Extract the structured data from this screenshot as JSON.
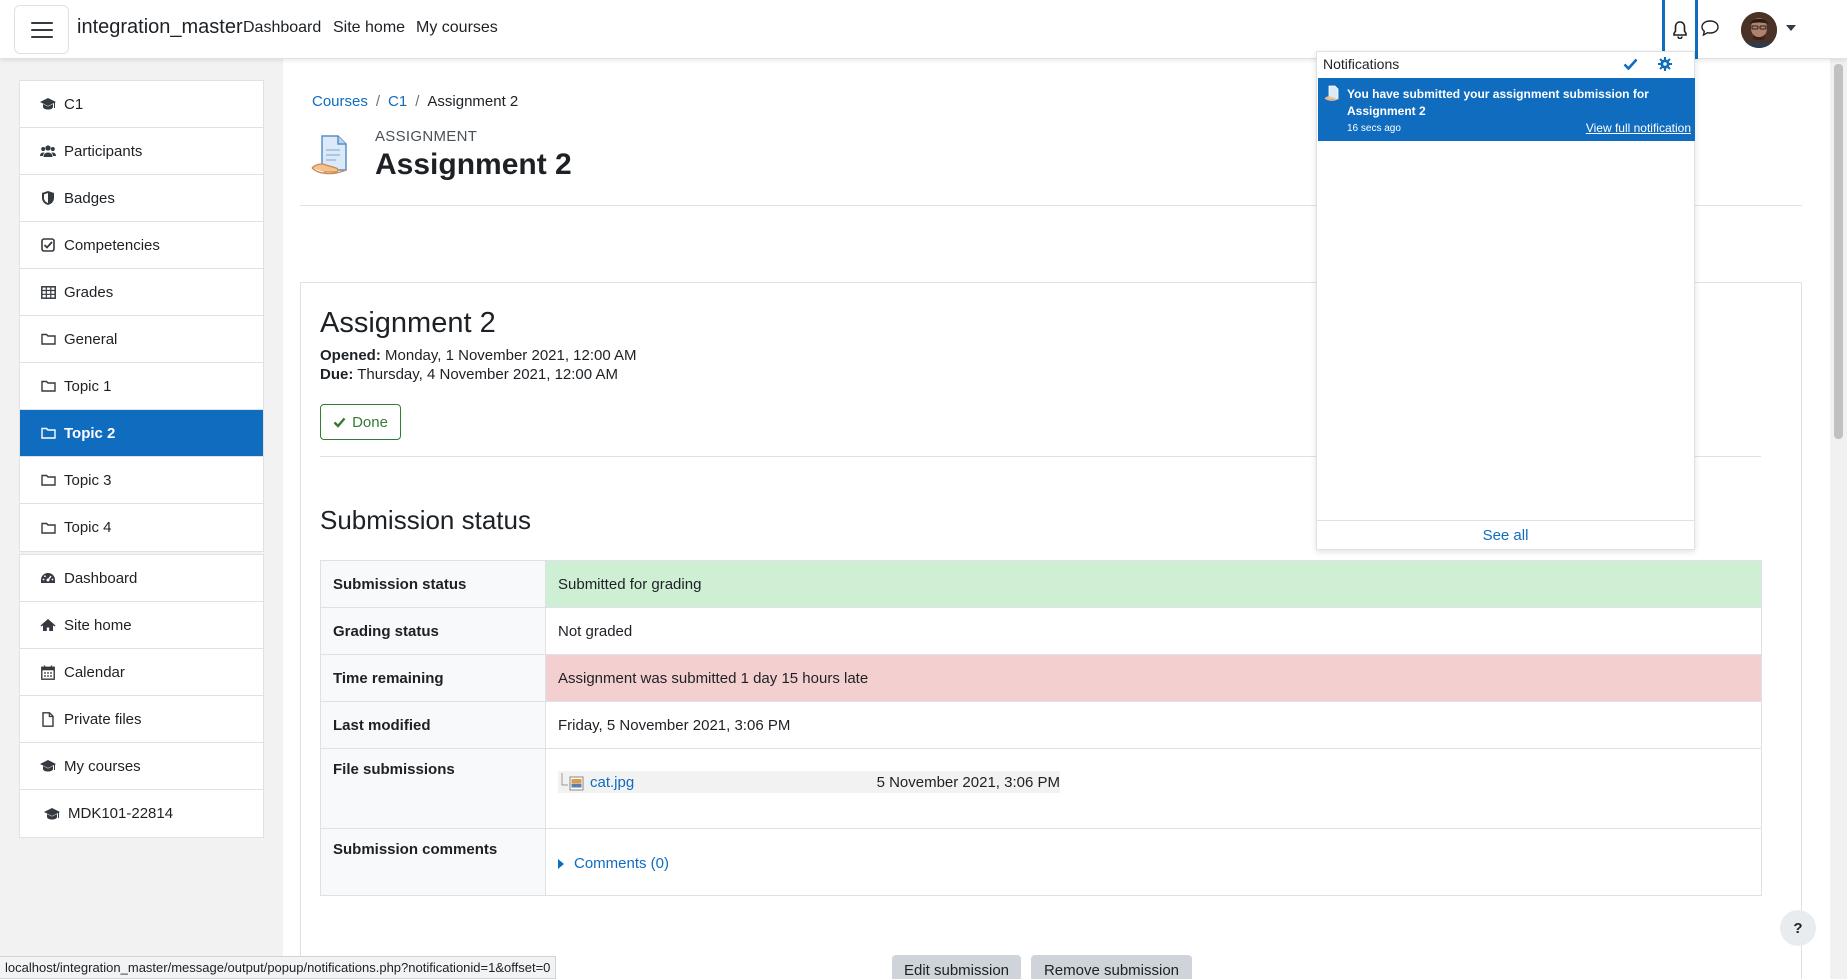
{
  "navbar": {
    "site_name": "integration_master",
    "links": [
      "Dashboard",
      "Site home",
      "My courses"
    ]
  },
  "sidebar": {
    "course_items": [
      {
        "label": "C1",
        "icon": "graduation-cap-icon"
      },
      {
        "label": "Participants",
        "icon": "users-icon"
      },
      {
        "label": "Badges",
        "icon": "shield-icon"
      },
      {
        "label": "Competencies",
        "icon": "check-square-icon"
      },
      {
        "label": "Grades",
        "icon": "table-icon"
      },
      {
        "label": "General",
        "icon": "folder-icon"
      },
      {
        "label": "Topic 1",
        "icon": "folder-icon"
      },
      {
        "label": "Topic 2",
        "icon": "folder-icon",
        "active": true
      },
      {
        "label": "Topic 3",
        "icon": "folder-icon"
      },
      {
        "label": "Topic 4",
        "icon": "folder-icon"
      }
    ],
    "site_items": [
      {
        "label": "Dashboard",
        "icon": "tachometer-icon"
      },
      {
        "label": "Site home",
        "icon": "home-icon"
      },
      {
        "label": "Calendar",
        "icon": "calendar-icon"
      },
      {
        "label": "Private files",
        "icon": "file-icon"
      },
      {
        "label": "My courses",
        "icon": "graduation-cap-icon"
      }
    ],
    "extra_items": [
      {
        "label": "MDK101-22814",
        "icon": "graduation-cap-icon"
      }
    ],
    "active_color": "#0f6cbf"
  },
  "breadcrumb": [
    "Courses",
    "C1",
    "Assignment 2"
  ],
  "header": {
    "module_type": "ASSIGNMENT",
    "title": "Assignment 2"
  },
  "assignment": {
    "heading": "Assignment 2",
    "opened_label": "Opened:",
    "opened_value": "Monday, 1 November 2021, 12:00 AM",
    "due_label": "Due:",
    "due_value": "Thursday, 4 November 2021, 12:00 AM",
    "done_label": "Done"
  },
  "submission": {
    "heading": "Submission status",
    "rows": [
      {
        "label": "Submission status",
        "value": "Submitted for grading",
        "status": "success"
      },
      {
        "label": "Grading status",
        "value": "Not graded"
      },
      {
        "label": "Time remaining",
        "value": "Assignment was submitted 1 day 15 hours late",
        "status": "danger"
      },
      {
        "label": "Last modified",
        "value": "Friday, 5 November 2021, 3:06 PM"
      }
    ],
    "file_label": "File submissions",
    "file_name": "cat.jpg",
    "file_date": "5 November 2021, 3:06 PM",
    "comments_label": "Submission comments",
    "comments_link": "Comments (0)",
    "colors": {
      "success": "#cfefd5",
      "danger": "#f4cfd0"
    }
  },
  "buttons": {
    "edit": "Edit submission",
    "remove": "Remove submission"
  },
  "notifications": {
    "title": "Notifications",
    "item_text": "You have submitted your assignment submission for Assignment 2",
    "item_time": "16 secs ago",
    "item_link": "View full notification",
    "see_all": "See all"
  },
  "help_label": "?",
  "status_url": "localhost/integration_master/message/output/popup/notifications.php?notificationid=1&offset=0"
}
